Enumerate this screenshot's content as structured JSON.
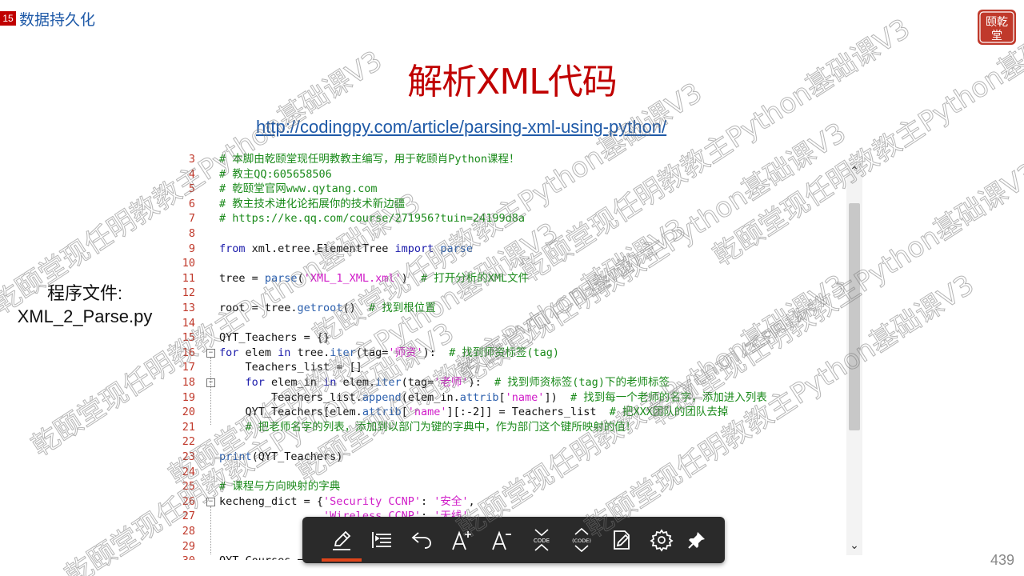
{
  "header": {
    "slide_badge": "15",
    "section_title": "数据持久化",
    "logo_text": "乾颐堂"
  },
  "title": "解析XML代码",
  "url": "http://codingpy.com/article/parsing-xml-using-python/",
  "file_label": {
    "line1": "程序文件:",
    "line2": "XML_2_Parse.py"
  },
  "editor": {
    "lines": [
      {
        "num": "3",
        "fold": false,
        "tokens": [
          {
            "t": "# 本脚由乾颐堂现任明教教主编写，用于乾颐肖Python课程！",
            "c": "comment"
          }
        ]
      },
      {
        "num": "4",
        "fold": false,
        "tokens": [
          {
            "t": "# 教主QQ:605658506",
            "c": "comment"
          }
        ]
      },
      {
        "num": "5",
        "fold": false,
        "tokens": [
          {
            "t": "# 乾颐堂官网www.qytang.com",
            "c": "comment"
          }
        ]
      },
      {
        "num": "6",
        "fold": false,
        "tokens": [
          {
            "t": "# 教主技术进化论拓展你的技术新边疆",
            "c": "comment"
          }
        ]
      },
      {
        "num": "7",
        "fold": false,
        "tokens": [
          {
            "t": "# https://ke.qq.com/course/271956?tuin=24199d8a",
            "c": "comment"
          }
        ]
      },
      {
        "num": "8",
        "fold": false,
        "tokens": []
      },
      {
        "num": "9",
        "fold": false,
        "tokens": [
          {
            "t": "from",
            "c": "keyword"
          },
          {
            "t": " xml.etree.ElementTree ",
            "c": "plain"
          },
          {
            "t": "import",
            "c": "keyword"
          },
          {
            "t": " parse",
            "c": "func"
          }
        ]
      },
      {
        "num": "10",
        "fold": false,
        "tokens": []
      },
      {
        "num": "11",
        "fold": false,
        "tokens": [
          {
            "t": "tree = ",
            "c": "plain"
          },
          {
            "t": "parse",
            "c": "func"
          },
          {
            "t": "(",
            "c": "plain"
          },
          {
            "t": "'XML_1_XML.xml'",
            "c": "string"
          },
          {
            "t": ")  ",
            "c": "plain"
          },
          {
            "t": "# 打开分析的XML文件",
            "c": "comment"
          }
        ]
      },
      {
        "num": "12",
        "fold": false,
        "tokens": []
      },
      {
        "num": "13",
        "fold": false,
        "tokens": [
          {
            "t": "root = tree.",
            "c": "plain"
          },
          {
            "t": "getroot",
            "c": "func"
          },
          {
            "t": "()  ",
            "c": "plain"
          },
          {
            "t": "# 找到根位置",
            "c": "comment"
          }
        ]
      },
      {
        "num": "14",
        "fold": false,
        "tokens": []
      },
      {
        "num": "15",
        "fold": false,
        "tokens": [
          {
            "t": "QYT_Teachers = {}",
            "c": "plain"
          }
        ]
      },
      {
        "num": "16",
        "fold": true,
        "tokens": [
          {
            "t": "for",
            "c": "keyword"
          },
          {
            "t": " elem ",
            "c": "plain"
          },
          {
            "t": "in",
            "c": "keyword"
          },
          {
            "t": " tree.",
            "c": "plain"
          },
          {
            "t": "iter",
            "c": "func"
          },
          {
            "t": "(tag=",
            "c": "plain"
          },
          {
            "t": "'师资'",
            "c": "string"
          },
          {
            "t": "):  ",
            "c": "plain"
          },
          {
            "t": "# 找到师资标签(tag)",
            "c": "comment"
          }
        ]
      },
      {
        "num": "17",
        "fold": false,
        "tokens": [
          {
            "t": "    Teachers_list = []",
            "c": "plain"
          }
        ]
      },
      {
        "num": "18",
        "fold": true,
        "tokens": [
          {
            "t": "    ",
            "c": "plain"
          },
          {
            "t": "for",
            "c": "keyword"
          },
          {
            "t": " elem_in ",
            "c": "plain"
          },
          {
            "t": "in",
            "c": "keyword"
          },
          {
            "t": " elem.",
            "c": "plain"
          },
          {
            "t": "iter",
            "c": "func"
          },
          {
            "t": "(tag=",
            "c": "plain"
          },
          {
            "t": "'老师'",
            "c": "string"
          },
          {
            "t": "):  ",
            "c": "plain"
          },
          {
            "t": "# 找到师资标签(tag)下的老师标签",
            "c": "comment"
          }
        ]
      },
      {
        "num": "19",
        "fold": false,
        "tokens": [
          {
            "t": "        Teachers_list.",
            "c": "plain"
          },
          {
            "t": "append",
            "c": "func"
          },
          {
            "t": "(elem_in.",
            "c": "plain"
          },
          {
            "t": "attrib",
            "c": "func"
          },
          {
            "t": "[",
            "c": "plain"
          },
          {
            "t": "'name'",
            "c": "string"
          },
          {
            "t": "])  ",
            "c": "plain"
          },
          {
            "t": "# 找到每一个老师的名字，添加进入列表",
            "c": "comment"
          }
        ]
      },
      {
        "num": "20",
        "fold": false,
        "tokens": [
          {
            "t": "    QYT_Teachers[elem.",
            "c": "plain"
          },
          {
            "t": "attrib",
            "c": "func"
          },
          {
            "t": "[",
            "c": "plain"
          },
          {
            "t": "'name'",
            "c": "string"
          },
          {
            "t": "][:-2]] = Teachers_list  ",
            "c": "plain"
          },
          {
            "t": "# 把XXX团队的团队去掉",
            "c": "comment"
          }
        ]
      },
      {
        "num": "21",
        "fold": false,
        "tokens": [
          {
            "t": "    ",
            "c": "plain"
          },
          {
            "t": "# 把老师名字的列表，添加到以部门为键的字典中，作为部门这个键所映射的值！",
            "c": "comment"
          }
        ]
      },
      {
        "num": "22",
        "fold": false,
        "tokens": []
      },
      {
        "num": "23",
        "fold": false,
        "tokens": [
          {
            "t": "print",
            "c": "func"
          },
          {
            "t": "(QYT_Teachers)",
            "c": "plain"
          }
        ]
      },
      {
        "num": "24",
        "fold": false,
        "tokens": []
      },
      {
        "num": "25",
        "fold": false,
        "tokens": [
          {
            "t": "# 课程与方向映射的字典",
            "c": "comment"
          }
        ]
      },
      {
        "num": "26",
        "fold": true,
        "tokens": [
          {
            "t": "kecheng_dict = {",
            "c": "plain"
          },
          {
            "t": "'Security CCNP'",
            "c": "string"
          },
          {
            "t": ": ",
            "c": "plain"
          },
          {
            "t": "'安全'",
            "c": "string"
          },
          {
            "t": ",",
            "c": "plain"
          }
        ]
      },
      {
        "num": "27",
        "fold": false,
        "tokens": [
          {
            "t": "                ",
            "c": "plain"
          },
          {
            "t": "'Wireless CCNP'",
            "c": "string"
          },
          {
            "t": ": ",
            "c": "plain"
          },
          {
            "t": "'无线'",
            "c": "string"
          },
          {
            "t": ",",
            "c": "plain"
          }
        ]
      },
      {
        "num": "28",
        "fold": false,
        "tokens": []
      },
      {
        "num": "29",
        "fold": false,
        "tokens": []
      },
      {
        "num": "30",
        "fold": false,
        "tokens": [
          {
            "t": "QYT_Courses = {}",
            "c": "plain"
          }
        ]
      }
    ]
  },
  "toolbar": {
    "buttons": [
      {
        "name": "pen-tool-button",
        "icon": "pencil-icon"
      },
      {
        "name": "outline-button",
        "icon": "list-indent-icon"
      },
      {
        "name": "undo-button",
        "icon": "undo-icon"
      },
      {
        "name": "font-increase-button",
        "icon": "font-increase-icon",
        "label": "A+"
      },
      {
        "name": "font-decrease-button",
        "icon": "font-decrease-icon",
        "label": "A-"
      },
      {
        "name": "collapse-code-button",
        "icon": "collapse-code-icon",
        "label": "CODE"
      },
      {
        "name": "expand-code-button",
        "icon": "expand-code-icon",
        "label": "(CODE)"
      },
      {
        "name": "notes-button",
        "icon": "edit-page-icon"
      },
      {
        "name": "settings-button",
        "icon": "gear-icon"
      },
      {
        "name": "pin-button",
        "icon": "pin-icon"
      }
    ]
  },
  "page_number": "439",
  "watermark_text": "乾颐堂现任明教教主Python基础课V3",
  "colors": {
    "title_red": "#c00000",
    "link_blue": "#1f5aa8",
    "comment_green": "#1a8a1a",
    "keyword_blue": "#1a1aaa",
    "string_magenta": "#d01cc8",
    "toolbar_bg": "#2a2a2a",
    "toolbar_active": "#e0451a"
  }
}
